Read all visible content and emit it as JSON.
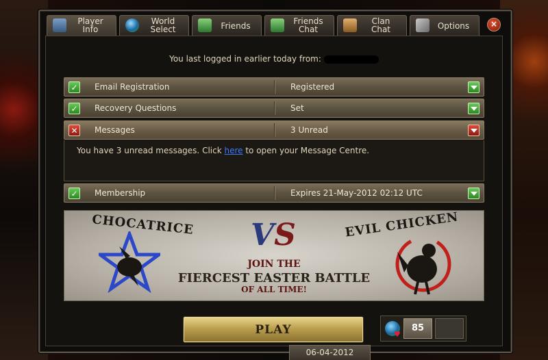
{
  "tabs": [
    {
      "label_line1": "Player",
      "label_line2": "Info",
      "icon": "player-icon"
    },
    {
      "label_line1": "World",
      "label_line2": "Select",
      "icon": "globe-icon"
    },
    {
      "label_line1": "Friends",
      "label_line2": "",
      "icon": "friends-icon"
    },
    {
      "label_line1": "Friends",
      "label_line2": "Chat",
      "icon": "friends-chat-icon"
    },
    {
      "label_line1": "Clan",
      "label_line2": "Chat",
      "icon": "clan-chat-icon"
    },
    {
      "label_line1": "Options",
      "label_line2": "",
      "icon": "tools-icon"
    }
  ],
  "close_symbol": "×",
  "last_login": "You last logged in earlier today from:",
  "rows": {
    "email": {
      "label": "Email Registration",
      "value": "Registered",
      "status": "ok"
    },
    "recovery": {
      "label": "Recovery Questions",
      "value": "Set",
      "status": "ok"
    },
    "messages": {
      "label": "Messages",
      "value": "3 Unread",
      "status": "bad"
    },
    "membership": {
      "label": "Membership",
      "value": "Expires 21-May-2012 02:12 UTC",
      "status": "ok"
    }
  },
  "messages_panel": {
    "before": "You have 3 unread messages. Click ",
    "link": "here",
    "after": " to open your Message Centre."
  },
  "banner": {
    "left_name": "CHOCATRICE",
    "right_name": "EVIL CHICKEN",
    "vs_v": "V",
    "vs_s": "S",
    "line1": "JOIN THE",
    "line2": "FIERCEST EASTER BATTLE",
    "line3": "OF ALL TIME!"
  },
  "play_label": "PLAY",
  "world_number": "85",
  "date": "06-04-2012",
  "colors": {
    "ok": "#2a8a20",
    "bad": "#8a1a10",
    "link": "#3a7aff"
  }
}
